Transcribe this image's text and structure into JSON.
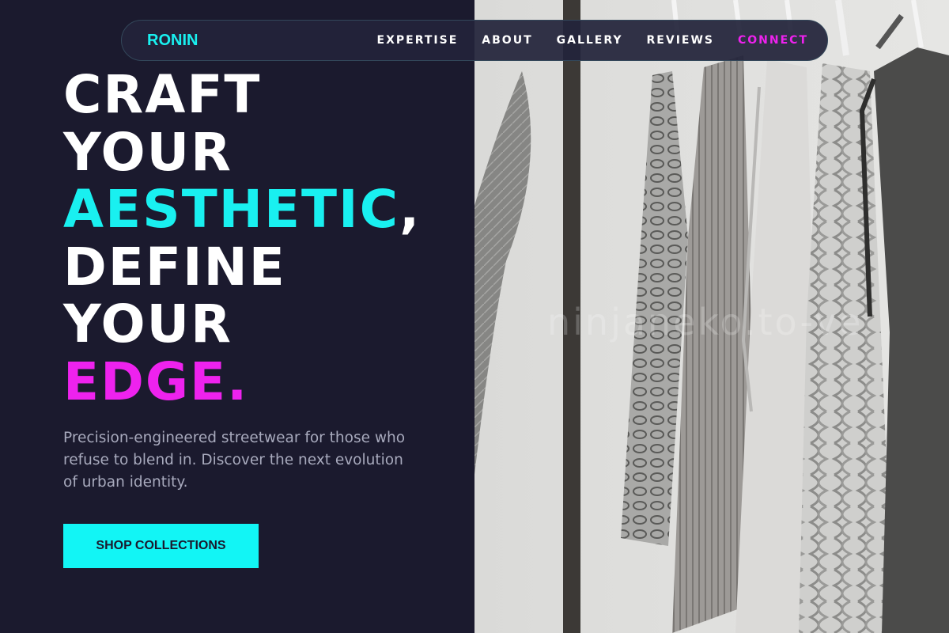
{
  "brand": {
    "name": "RONIN"
  },
  "nav": {
    "links": [
      {
        "label": "EXPERTISE"
      },
      {
        "label": "ABOUT"
      },
      {
        "label": "GALLERY"
      },
      {
        "label": "REVIEWS"
      },
      {
        "label": "CONNECT"
      }
    ]
  },
  "hero": {
    "line1": "CRAFT",
    "line2": "YOUR",
    "line3_accent": "AESTHETIC",
    "line3_punct": ",",
    "line4": "DEFINE",
    "line5": "YOUR",
    "line6_accent": "EDGE.",
    "subtext": "Precision-engineered streetwear for those who refuse to blend in. Discover the next evolution of urban identity.",
    "cta_label": "SHOP COLLECTIONS"
  },
  "image": {
    "watermark": "ninjaneko.to-ve"
  },
  "colors": {
    "background": "#1b1a2e",
    "cyan": "#19f0f0",
    "magenta": "#ee22ee",
    "muted": "#a8aabd"
  }
}
